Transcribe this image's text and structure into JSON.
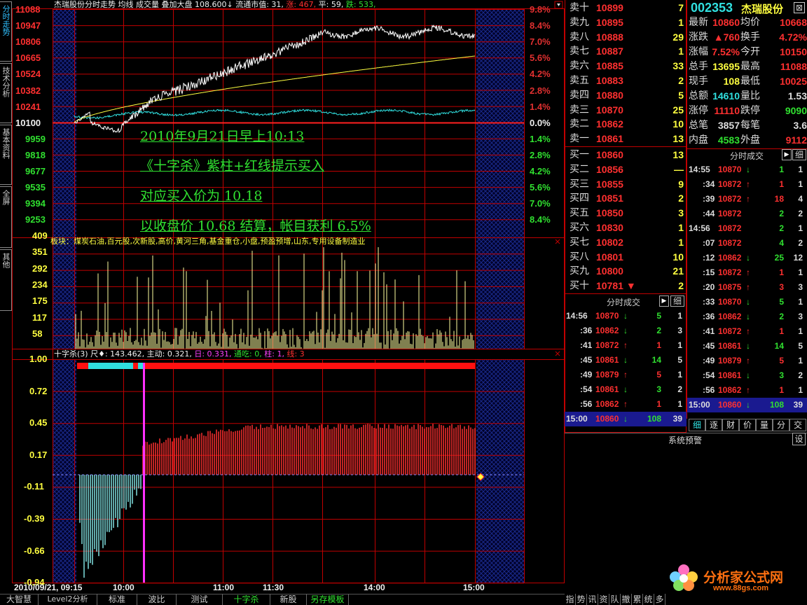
{
  "header": {
    "info_line": "杰瑞股份分时走势  均线  成交量  叠加大盘",
    "overlay_val": "108.600↓",
    "mktcap_label": "流通市值: 31,",
    "up_label": "涨: 467,",
    "flat_label": "平: 59,",
    "down_label": "跌: 533,"
  },
  "price_axis": {
    "left": [
      "11088",
      "10947",
      "10806",
      "10665",
      "10524",
      "10382",
      "10241",
      "10100",
      "9959",
      "9818",
      "9677",
      "9535",
      "9394",
      "9253"
    ],
    "right": [
      "9.8%",
      "8.4%",
      "7.0%",
      "5.6%",
      "4.2%",
      "2.8%",
      "1.4%",
      "0.0%",
      "1.4%",
      "2.8%",
      "4.2%",
      "5.6%",
      "7.0%",
      "8.4%"
    ]
  },
  "volume_axis": [
    "409",
    "351",
    "292",
    "234",
    "175",
    "117",
    "58"
  ],
  "sector_line": "板块：煤炭石油,百元股,次新股,高价,黄河三角,基金重仓,小盘,预盈预增,山东,专用设备制造业",
  "indicator": {
    "title": "十字杀(3) 尺♦: 143.462,",
    "main_label": "主动: 0.321,",
    "day_label": "日: 0.331,",
    "tongchi_label": "通吃: 0,",
    "zhu_label": "柱: 1,",
    "xian_label": "线: 3",
    "axis": [
      "1.00",
      "0.72",
      "0.45",
      "0.17",
      "-0.11",
      "-0.39",
      "-0.66",
      "-0.94"
    ]
  },
  "time_axis": {
    "start": "2010/09/21, 09:15",
    "t1": "10:00",
    "t2": "11:00",
    "t3": "11:30",
    "t4": "14:00",
    "t5": "15:00"
  },
  "annotations": [
    "2010年9月21日早上10:13",
    "《十字杀》紫柱+红线提示买入",
    "对应买入价为 10.18",
    "以收盘价 10.68 结算，帐目获利 6.5%"
  ],
  "side_tabs": [
    "分时走势",
    "技术分析",
    "基本资料",
    "全屏",
    "其他"
  ],
  "orderbook": {
    "sell": [
      {
        "n": "卖十",
        "p": "10899",
        "v": "7"
      },
      {
        "n": "卖九",
        "p": "10895",
        "v": "1"
      },
      {
        "n": "卖八",
        "p": "10888",
        "v": "29"
      },
      {
        "n": "卖七",
        "p": "10887",
        "v": "1"
      },
      {
        "n": "卖六",
        "p": "10885",
        "v": "33"
      },
      {
        "n": "卖五",
        "p": "10883",
        "v": "2"
      },
      {
        "n": "卖四",
        "p": "10880",
        "v": "5"
      },
      {
        "n": "卖三",
        "p": "10870",
        "v": "25"
      },
      {
        "n": "卖二",
        "p": "10862",
        "v": "10"
      },
      {
        "n": "卖一",
        "p": "10861",
        "v": "13"
      }
    ],
    "buy": [
      {
        "n": "买一",
        "p": "10860",
        "v": "13"
      },
      {
        "n": "买二",
        "p": "10856",
        "v": "—"
      },
      {
        "n": "买三",
        "p": "10855",
        "v": "9"
      },
      {
        "n": "买四",
        "p": "10851",
        "v": "2"
      },
      {
        "n": "买五",
        "p": "10850",
        "v": "3"
      },
      {
        "n": "买六",
        "p": "10830",
        "v": "1"
      },
      {
        "n": "买七",
        "p": "10802",
        "v": "1"
      },
      {
        "n": "买八",
        "p": "10801",
        "v": "10"
      },
      {
        "n": "买九",
        "p": "10800",
        "v": "21"
      },
      {
        "n": "买十",
        "p": "10781 ▼",
        "v": "2"
      }
    ]
  },
  "stock": {
    "code": "002353",
    "name": "杰瑞股份"
  },
  "quote": [
    {
      "a": "最新",
      "b": "10860",
      "c": "均价",
      "d": "10668"
    },
    {
      "a": "涨跌",
      "b": "▲760",
      "c": "换手",
      "d": "4.72%"
    },
    {
      "a": "涨幅",
      "b": "7.52%",
      "c": "今开",
      "d": "10150"
    },
    {
      "a": "总手",
      "b": "13695",
      "c": "最高",
      "d": "11088"
    },
    {
      "a": "现手",
      "b": "108",
      "c": "最低",
      "d": "10025"
    },
    {
      "a": "总额",
      "b": "14610",
      "c": "量比",
      "d": "1.53"
    },
    {
      "a": "涨停",
      "b": "11110",
      "c": "跌停",
      "d": "9090"
    },
    {
      "a": "总笔",
      "b": "3857",
      "c": "每笔",
      "d": "3.6"
    },
    {
      "a": "内盘",
      "b": "4583",
      "c": "外盘",
      "d": "9112"
    }
  ],
  "ticks_header": "分时成交",
  "detail_label": "细",
  "ticks_right": [
    {
      "t": "14:55",
      "p": "10870",
      "d": "down",
      "v": "1",
      "c": "1"
    },
    {
      "t": ":34",
      "p": "10872",
      "d": "up",
      "v": "1",
      "c": "1"
    },
    {
      "t": ":39",
      "p": "10872",
      "d": "up",
      "v": "18",
      "c": "4"
    },
    {
      "t": ":44",
      "p": "10872",
      "d": "",
      "v": "2",
      "c": "2"
    },
    {
      "t": "14:56",
      "p": "10872",
      "d": "",
      "v": "2",
      "c": "1"
    },
    {
      "t": ":07",
      "p": "10872",
      "d": "",
      "v": "4",
      "c": "2"
    },
    {
      "t": ":12",
      "p": "10862",
      "d": "down",
      "v": "25",
      "c": "12"
    },
    {
      "t": ":15",
      "p": "10872",
      "d": "up",
      "v": "1",
      "c": "1"
    },
    {
      "t": ":20",
      "p": "10875",
      "d": "up",
      "v": "3",
      "c": "3"
    },
    {
      "t": ":33",
      "p": "10870",
      "d": "down",
      "v": "5",
      "c": "1"
    },
    {
      "t": ":36",
      "p": "10862",
      "d": "down",
      "v": "2",
      "c": "3"
    },
    {
      "t": ":41",
      "p": "10872",
      "d": "up",
      "v": "1",
      "c": "1"
    },
    {
      "t": ":45",
      "p": "10861",
      "d": "down",
      "v": "14",
      "c": "5"
    },
    {
      "t": ":49",
      "p": "10879",
      "d": "up",
      "v": "5",
      "c": "1"
    },
    {
      "t": ":54",
      "p": "10861",
      "d": "down",
      "v": "3",
      "c": "2"
    },
    {
      "t": ":56",
      "p": "10862",
      "d": "up",
      "v": "1",
      "c": "1"
    },
    {
      "t": "15:00",
      "p": "10860",
      "d": "down",
      "v": "108",
      "c": "39"
    }
  ],
  "ticks_left": [
    {
      "t": "14:56",
      "p": "10870",
      "d": "down",
      "v": "5",
      "c": "1"
    },
    {
      "t": ":36",
      "p": "10862",
      "d": "down",
      "v": "2",
      "c": "3"
    },
    {
      "t": ":41",
      "p": "10872",
      "d": "up",
      "v": "1",
      "c": "1"
    },
    {
      "t": ":45",
      "p": "10861",
      "d": "down",
      "v": "14",
      "c": "5"
    },
    {
      "t": ":49",
      "p": "10879",
      "d": "up",
      "v": "5",
      "c": "1"
    },
    {
      "t": ":54",
      "p": "10861",
      "d": "down",
      "v": "3",
      "c": "2"
    },
    {
      "t": ":56",
      "p": "10862",
      "d": "up",
      "v": "1",
      "c": "1"
    },
    {
      "t": "15:00",
      "p": "10860",
      "d": "down",
      "v": "108",
      "c": "39"
    }
  ],
  "right_tabs": [
    "细",
    "逐",
    "财",
    "价",
    "量",
    "分",
    "交"
  ],
  "alert": {
    "title": "系统预警",
    "btn": "设"
  },
  "bottom_tabs": [
    "大智慧",
    "Level2分析",
    "标准",
    "波比",
    "测试",
    "十字杀",
    "新股",
    "另存模板"
  ],
  "bottom_right_tabs": [
    "指",
    "势",
    "讯",
    "资",
    "队",
    "撤",
    "累",
    "统",
    "多"
  ],
  "watermark": {
    "text": "分析家公式网",
    "url": "www.88gs.com"
  },
  "colors": {
    "up": "#ff3030",
    "down": "#30e030",
    "frame": "#c00000",
    "price": "#ffffff",
    "avg": "#ffff40"
  }
}
